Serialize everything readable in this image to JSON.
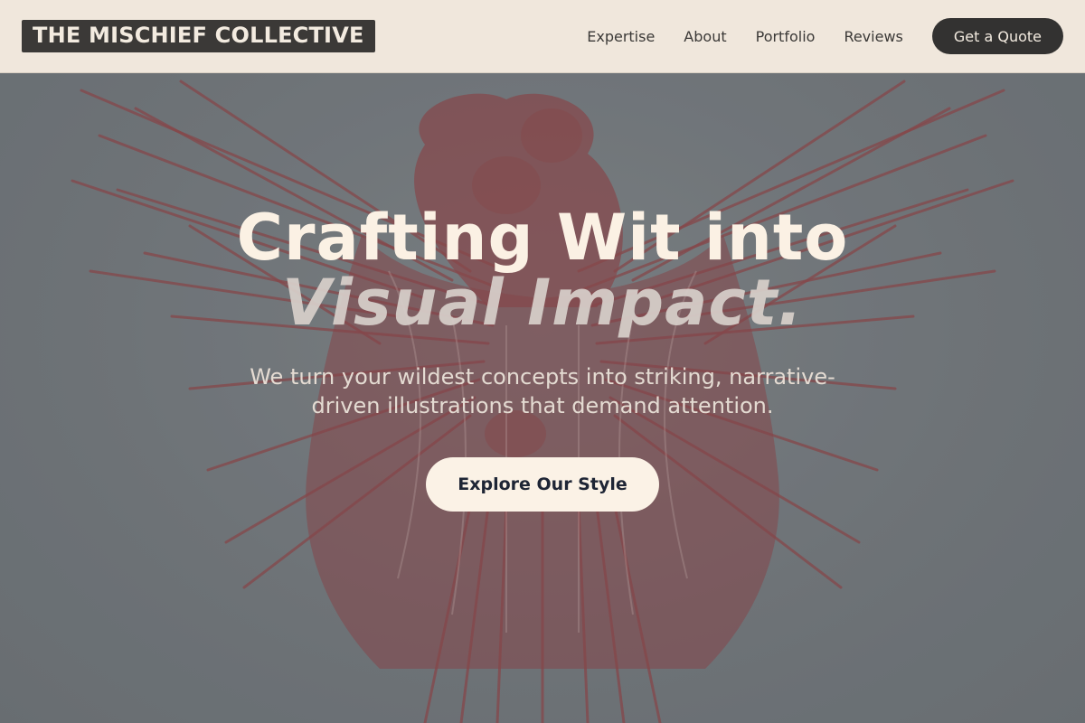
{
  "header": {
    "logo": "THE MISCHIEF COLLECTIVE",
    "nav": [
      {
        "label": "Expertise"
      },
      {
        "label": "About"
      },
      {
        "label": "Portfolio"
      },
      {
        "label": "Reviews"
      }
    ],
    "cta_label": "Get a Quote"
  },
  "hero": {
    "headline_line1": "Crafting Wit into",
    "headline_line2": "Visual Impact.",
    "subtitle": "We turn your wildest concepts into striking, narrative-driven illustrations that demand attention.",
    "cta_label": "Explore Our Style",
    "artwork_name": "winged-angels-illustration"
  },
  "colors": {
    "header_bg": "#f0e7dc",
    "logo_bg": "#3b3937",
    "hero_bg": "#6f7478",
    "artwork_red": "#8a3b3d",
    "cta_bg": "#fbf2e6",
    "cta_text": "#1e2535"
  }
}
